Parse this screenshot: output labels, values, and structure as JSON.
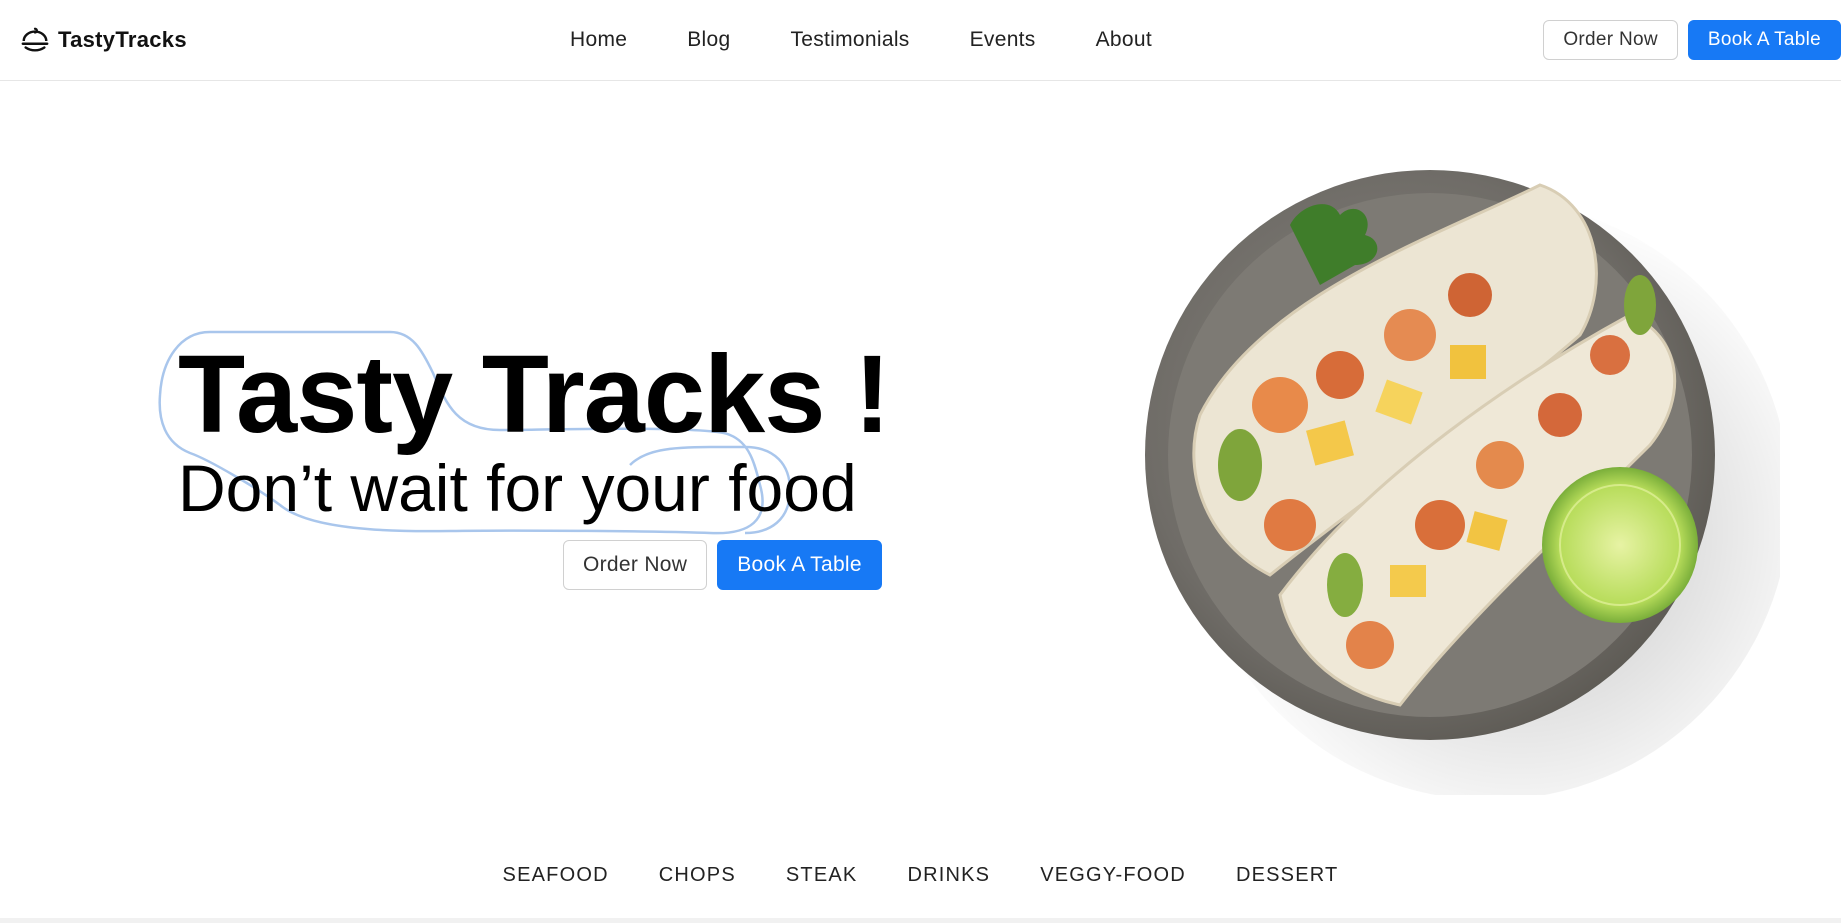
{
  "brand": {
    "name": "TastyTracks",
    "logo_icon": "food-cloche-icon"
  },
  "nav": {
    "links": [
      "Home",
      "Blog",
      "Testimonials",
      "Events",
      "About"
    ],
    "order_label": "Order Now",
    "book_label": "Book A Table"
  },
  "hero": {
    "title": "Tasty Tracks !",
    "subtitle": "Don’t wait for your food",
    "order_label": "Order Now",
    "book_label": "Book A Table",
    "image_icon": "shrimp-taco-plate-image"
  },
  "categories": [
    "SEAFOOD",
    "CHOPS",
    "STEAK",
    "DRINKS",
    "VEGGY-FOOD",
    "DESSERT"
  ],
  "colors": {
    "primary": "#1779f5",
    "outline_accent": "#a9c6ec",
    "text": "#111111",
    "border": "#d0d0d0"
  }
}
